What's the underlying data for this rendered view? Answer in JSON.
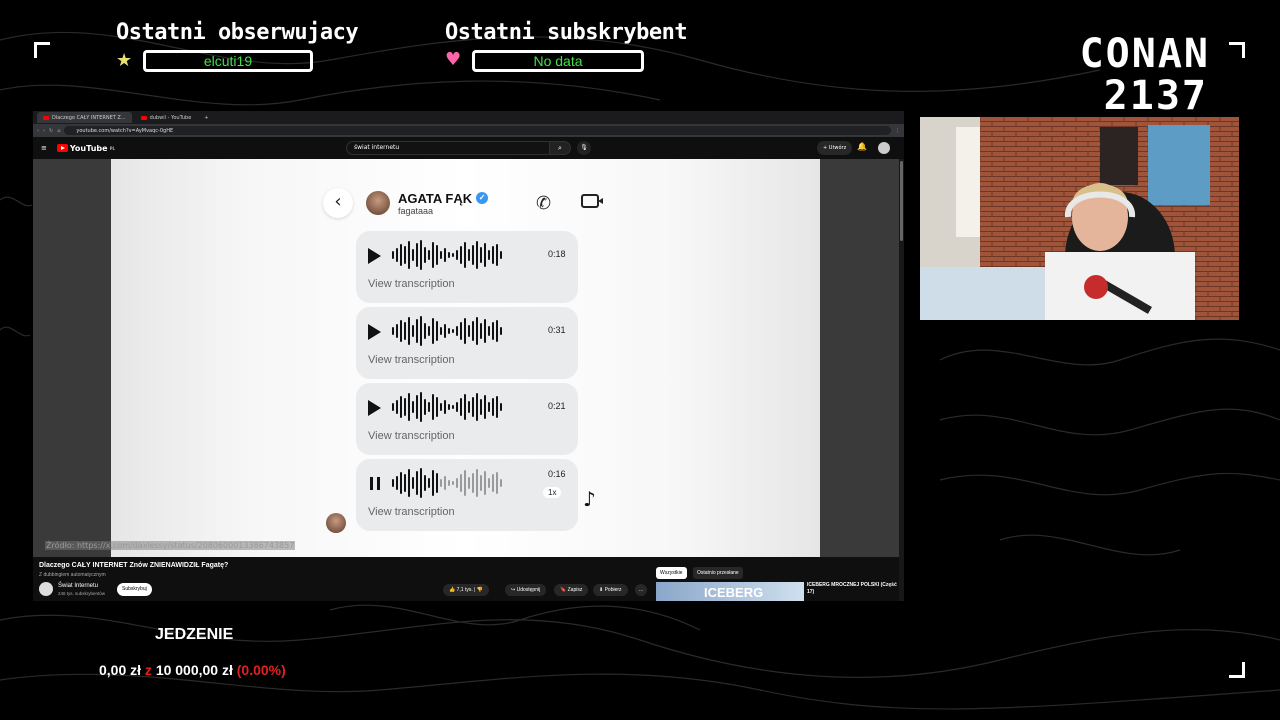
{
  "overlay": {
    "last_follower_title": "Ostatni obserwujacy",
    "last_follower_value": "elcuti19",
    "last_sub_title": "Ostatni subskrybent",
    "last_sub_value": "No data",
    "channel_line1": "CONAN",
    "channel_line2": "2137",
    "goal_title": "JEDZENIE",
    "goal_current": "0,00 zł",
    "goal_sep": "z",
    "goal_target": "10 000,00 zł",
    "goal_percent": "(0.00%)",
    "star_icon": "star-icon",
    "heart_icon": "heart-icon"
  },
  "browser": {
    "tabs": [
      {
        "label": "Dlaczego CAŁY INTERNET Z...",
        "active": true
      },
      {
        "label": "dubwil - YouTube",
        "active": false
      }
    ],
    "url": "youtube.com/watch?v=AyMvaqc-0gHE"
  },
  "youtube": {
    "logo": "YouTube",
    "logo_sup": "PL",
    "search_value": "świat internetu",
    "create_label": "+ Utwórz",
    "video_title": "Dlaczego CAŁY INTERNET Znów ZNIENAWIDZIŁ Fagatę?",
    "dub_note": "Z dubbingiem automatycznym",
    "channel_name": "Świat Internetu",
    "channel_subs": "246 tys. subskrybentów",
    "subscribe_label": "Subskrybuj",
    "like_count": "7,1 tys.",
    "share_label": "Udostępnij",
    "save_label": "Zapisz",
    "download_label": "Pobierz",
    "more_label": "...",
    "chip_all": "Wszystkie",
    "chip_recent": "Ostatnio przesłane",
    "rec_thumb_text": "ICEBERG",
    "rec_title": "ICEBERG MROCZNEJ POLSKI (Część 17)"
  },
  "dm": {
    "name": "AGATA FĄK",
    "username": "fagataaa",
    "messages": [
      {
        "duration": "0:18",
        "transcription": "View transcription",
        "playing": false
      },
      {
        "duration": "0:31",
        "transcription": "View transcription",
        "playing": false
      },
      {
        "duration": "0:21",
        "transcription": "View transcription",
        "playing": false
      },
      {
        "duration": "0:16",
        "transcription": "View transcription",
        "playing": true,
        "rate": "1x"
      }
    ],
    "source": "Źródło: https://x.com/daxlessy/status/2080600013386743857"
  },
  "colors": {
    "accent_red": "#e32020",
    "overlay_green": "#44e04a",
    "yt_red": "#ff0000"
  }
}
